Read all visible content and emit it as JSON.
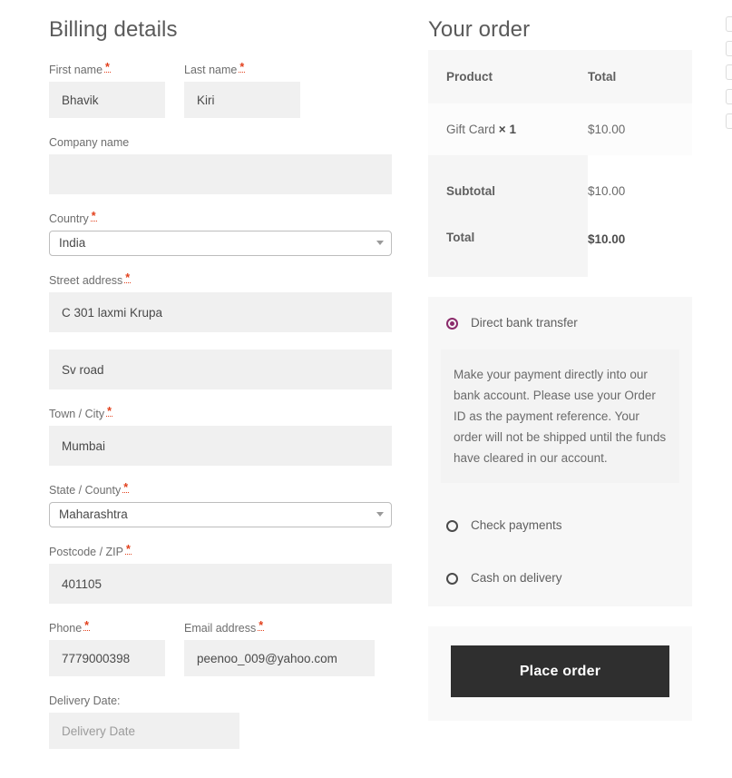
{
  "billing": {
    "title": "Billing details",
    "required_mark": "*",
    "fields": [
      {
        "label": "First name",
        "required": true,
        "value": "Bhavik",
        "placeholder": ""
      },
      {
        "label": "Last name",
        "required": true,
        "value": "Kiri",
        "placeholder": ""
      },
      {
        "label": "Company name",
        "required": false,
        "value": "",
        "placeholder": ""
      },
      {
        "label": "Country",
        "required": true,
        "value": "India",
        "type": "select"
      },
      {
        "label": "Street address",
        "required": true,
        "value": "C 301 laxmi Krupa",
        "placeholder": ""
      },
      {
        "label": "",
        "required": false,
        "value": "Sv road",
        "placeholder": ""
      },
      {
        "label": "Town / City",
        "required": true,
        "value": "Mumbai",
        "placeholder": ""
      },
      {
        "label": "State / County",
        "required": true,
        "value": "Maharashtra",
        "type": "select"
      },
      {
        "label": "Postcode / ZIP",
        "required": true,
        "value": "401105",
        "placeholder": ""
      },
      {
        "label": "Phone",
        "required": true,
        "value": "7779000398",
        "placeholder": ""
      },
      {
        "label": "Email address",
        "required": true,
        "value": "peenoo_009@yahoo.com",
        "placeholder": ""
      },
      {
        "label": "Delivery Date:",
        "required": false,
        "value": "",
        "placeholder": "Delivery Date"
      }
    ]
  },
  "order": {
    "title": "Your order",
    "table": {
      "headers": [
        "Product",
        "Total"
      ],
      "items": [
        {
          "name": "Gift Card",
          "qty_separator": "×",
          "qty": "1",
          "total": "$10.00"
        }
      ],
      "footer": [
        {
          "label": "Subtotal",
          "value": "$10.00"
        },
        {
          "label": "Total",
          "value": "$10.00"
        }
      ]
    },
    "payment_methods": [
      {
        "label": "Direct bank transfer",
        "selected": true
      },
      {
        "label": "Check payments",
        "selected": false
      },
      {
        "label": "Cash on delivery",
        "selected": false
      }
    ],
    "payment_description": "Make your payment directly into our bank account. Please use your Order ID as the payment reference. Your order will not be shipped until the funds have cleared in our account.",
    "place_order_label": "Place order"
  },
  "colors": {
    "radio_selected": "#8b2b6b",
    "required_mark": "#e2401c",
    "button_background": "#2f2f2f",
    "input_background": "#f0f0f0"
  }
}
